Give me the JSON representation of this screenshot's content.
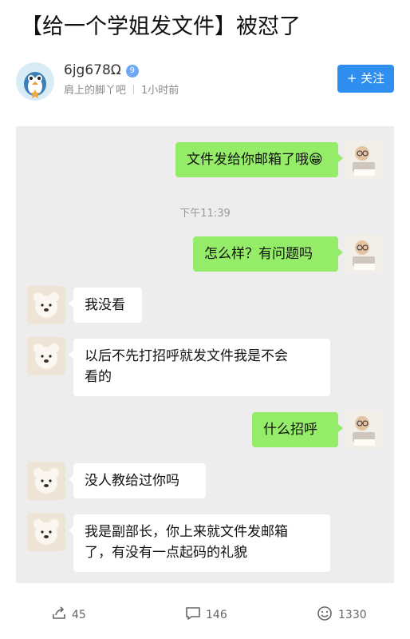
{
  "post": {
    "title": "【给一个学姐发文件】被怼了"
  },
  "author": {
    "name": "6jg678Ω",
    "level_badge": "9",
    "forum": "肩上的脚丫吧",
    "time": "1小时前"
  },
  "follow_button": {
    "label": "+ 关注"
  },
  "chat": {
    "messages": [
      {
        "side": "right",
        "text": "文件发给你邮箱了哦😁"
      },
      {
        "side": "time",
        "text": "下午11:39"
      },
      {
        "side": "right",
        "text": "怎么样？有问题吗"
      },
      {
        "side": "left",
        "text": "我没看"
      },
      {
        "side": "left",
        "line1": "以后不先打招呼就发文件我是不会",
        "line2": "看的"
      },
      {
        "side": "right",
        "text": "什么招呼"
      },
      {
        "side": "left",
        "text": "没人教给过你吗"
      },
      {
        "side": "left",
        "line1": "我是副部长，你上来就文件发邮箱",
        "line2": "了，有没有一点起码的礼貌"
      }
    ]
  },
  "actions": {
    "share_count": "45",
    "comment_count": "146",
    "like_count": "1330"
  },
  "colors": {
    "follow_blue": "#2f8ff0",
    "bubble_green": "#95ec69",
    "chat_bg": "#ededed"
  }
}
